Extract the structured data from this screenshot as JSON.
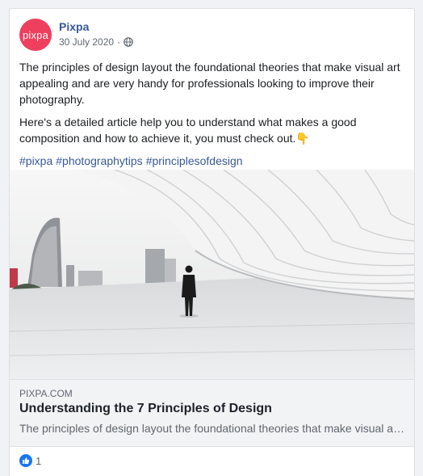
{
  "post": {
    "avatar_text": "pixpa",
    "author": "Pixpa",
    "date": "30 July 2020",
    "separator": "·",
    "paragraph1": "The principles of design layout the foundational theories that make visual art appealing and are very handy for professionals looking to improve their photography.",
    "paragraph2": "Here's a detailed article help you to understand what makes a good composition and how to achieve it, you must check out.",
    "emoji": "👇",
    "hashtags": [
      "#pixpa",
      "#photographytips",
      "#principlesofdesign"
    ]
  },
  "link_preview": {
    "domain": "PIXPA.COM",
    "title": "Understanding the 7 Principles of Design",
    "description": "The principles of design layout the foundational theories that make visual art appealing and are very handy for professionals looking to improve their photography."
  },
  "reactions": {
    "like_count": "1"
  },
  "colors": {
    "brand": "#ee3f5e",
    "link": "#385898",
    "like": "#1877f2"
  }
}
